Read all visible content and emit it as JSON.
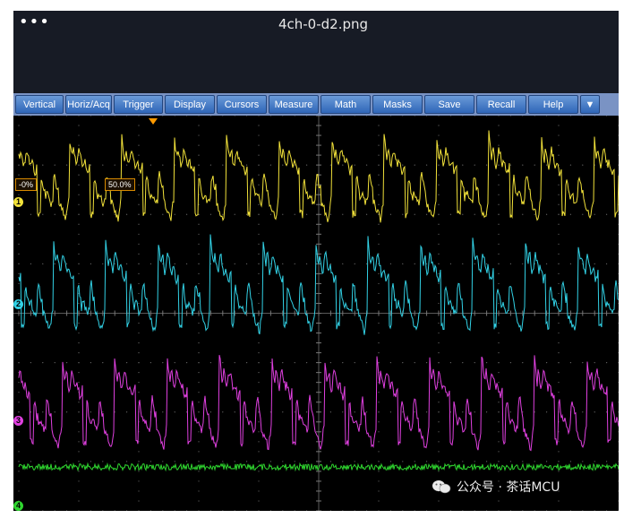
{
  "window": {
    "menu_dots": "•••",
    "title": "4ch-0-d2.png"
  },
  "menu": [
    {
      "label": "Vertical"
    },
    {
      "label": "Horiz/Acq"
    },
    {
      "label": "Trigger"
    },
    {
      "label": "Display"
    },
    {
      "label": "Cursors"
    },
    {
      "label": "Measure"
    },
    {
      "label": "Math"
    },
    {
      "label": "Masks"
    },
    {
      "label": "Save"
    },
    {
      "label": "Recall"
    },
    {
      "label": "Help"
    },
    {
      "label": "▼"
    }
  ],
  "scope": {
    "channels": [
      {
        "label": "1",
        "color": "#f2e23a"
      },
      {
        "label": "2",
        "color": "#32d2e6"
      },
      {
        "label": "3",
        "color": "#e040e0"
      },
      {
        "label": "4",
        "color": "#2fd62f"
      }
    ],
    "position_markers": [
      "-0%",
      "50.0%"
    ],
    "trigger_marker_color": "#ff9a00"
  },
  "watermark": {
    "icon": "wechat-icon",
    "text": "公众号 · 茶话MCU"
  }
}
